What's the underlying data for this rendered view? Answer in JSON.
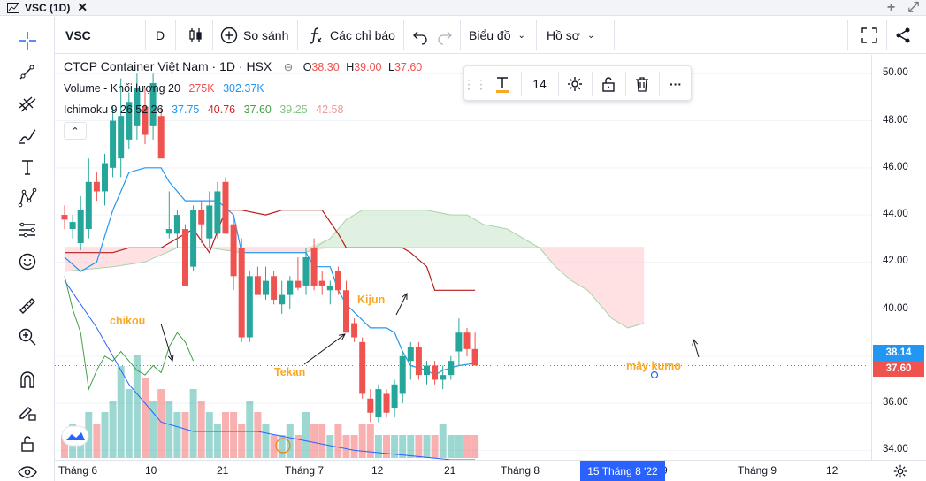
{
  "window": {
    "title": "VSC (1D)"
  },
  "toolbar": {
    "symbol": "VSC",
    "interval": "D",
    "compare_label": "So sánh",
    "indicators_label": "Các chỉ báo",
    "chart_label": "Biểu đồ",
    "profile_label": "Hồ sơ"
  },
  "legend": {
    "instrument": "CTCP Container Việt Nam · 1D · HSX",
    "ohlc": {
      "o_label": "O",
      "o_value": "38.30",
      "h_label": "H",
      "h_value": "39.00",
      "l_label": "L",
      "l_value": "37.60"
    },
    "volume": {
      "name": "Volume - Khối lượng 20",
      "value1": "275K",
      "value2": "302.37K"
    },
    "ichimoku": {
      "name": "Ichimoku 9 26 52 26",
      "v1": "37.75",
      "v2": "40.76",
      "v3": "37.60",
      "v4": "39.25",
      "v5": "42.58"
    }
  },
  "text_toolbar": {
    "font_size": "14"
  },
  "price_axis": {
    "labels": [
      "50.00",
      "48.00",
      "46.00",
      "44.00",
      "42.00",
      "40.00",
      "36.00",
      "34.00"
    ],
    "crosshair_tag": "38.14",
    "last_price_tag": "37.60"
  },
  "time_axis": {
    "labels": [
      "Tháng 6",
      "10",
      "21",
      "Tháng 7",
      "12",
      "21",
      "Tháng 8",
      "9",
      "Tháng 9",
      "12"
    ],
    "cursor_tag": "15 Tháng 8 '22"
  },
  "annotations": {
    "chikou": "chikou",
    "kijun": "Kijun",
    "tekan": "Tekan",
    "kumo": "mây kumo"
  },
  "colors": {
    "up": "#26a69a",
    "down": "#ef5350",
    "tenkan": "#2196f3",
    "kijun": "#b71c1c",
    "chikou": "#43a047",
    "kumo_green": "#c8e6c9",
    "kumo_red": "#ffcdd2",
    "annotation": "#f9a825",
    "accent": "#2962ff"
  },
  "chart_data": {
    "type": "candlestick",
    "ylim": [
      33.6,
      50.8
    ],
    "candles": [
      {
        "o": 44.0,
        "h": 44.4,
        "l": 43.4,
        "c": 43.8
      },
      {
        "o": 43.4,
        "h": 44.0,
        "l": 43.0,
        "c": 43.7
      },
      {
        "o": 42.8,
        "h": 44.8,
        "l": 42.5,
        "c": 44.2
      },
      {
        "o": 43.4,
        "h": 46.4,
        "l": 43.0,
        "c": 45.4
      },
      {
        "o": 45.4,
        "h": 45.8,
        "l": 44.6,
        "c": 45.0
      },
      {
        "o": 45.0,
        "h": 46.6,
        "l": 44.4,
        "c": 46.2
      },
      {
        "o": 46.0,
        "h": 48.6,
        "l": 45.6,
        "c": 48.0
      },
      {
        "o": 46.4,
        "h": 49.8,
        "l": 45.6,
        "c": 48.2
      },
      {
        "o": 47.2,
        "h": 49.2,
        "l": 46.8,
        "c": 48.8
      },
      {
        "o": 47.8,
        "h": 50.0,
        "l": 47.2,
        "c": 49.4
      },
      {
        "o": 48.6,
        "h": 49.4,
        "l": 47.0,
        "c": 47.4
      },
      {
        "o": 47.8,
        "h": 50.0,
        "l": 47.2,
        "c": 49.6
      },
      {
        "o": 48.2,
        "h": 48.6,
        "l": 46.4,
        "c": 46.4
      },
      {
        "o": 43.2,
        "h": 45.0,
        "l": 43.0,
        "c": 43.4
      },
      {
        "o": 43.2,
        "h": 44.2,
        "l": 42.6,
        "c": 44.0
      },
      {
        "o": 43.4,
        "h": 43.6,
        "l": 41.0,
        "c": 41.0
      },
      {
        "o": 41.8,
        "h": 44.4,
        "l": 41.6,
        "c": 44.2
      },
      {
        "o": 44.2,
        "h": 44.6,
        "l": 42.8,
        "c": 43.6
      },
      {
        "o": 43.0,
        "h": 45.0,
        "l": 42.6,
        "c": 44.4
      },
      {
        "o": 43.2,
        "h": 45.4,
        "l": 43.0,
        "c": 45.0
      },
      {
        "o": 45.4,
        "h": 45.6,
        "l": 43.2,
        "c": 43.2
      },
      {
        "o": 43.6,
        "h": 43.8,
        "l": 40.8,
        "c": 41.4
      },
      {
        "o": 42.6,
        "h": 43.0,
        "l": 38.6,
        "c": 38.8
      },
      {
        "o": 38.8,
        "h": 41.6,
        "l": 38.6,
        "c": 41.4
      },
      {
        "o": 41.4,
        "h": 41.8,
        "l": 40.6,
        "c": 40.6
      },
      {
        "o": 40.6,
        "h": 41.8,
        "l": 40.4,
        "c": 41.2
      },
      {
        "o": 41.4,
        "h": 41.6,
        "l": 40.2,
        "c": 40.4
      },
      {
        "o": 40.2,
        "h": 41.2,
        "l": 39.8,
        "c": 40.6
      },
      {
        "o": 40.6,
        "h": 41.4,
        "l": 40.0,
        "c": 41.2
      },
      {
        "o": 41.2,
        "h": 42.2,
        "l": 40.8,
        "c": 40.9
      },
      {
        "o": 41.0,
        "h": 42.6,
        "l": 40.6,
        "c": 42.2
      },
      {
        "o": 42.6,
        "h": 43.0,
        "l": 40.8,
        "c": 41.0
      },
      {
        "o": 41.2,
        "h": 41.6,
        "l": 40.6,
        "c": 41.0
      },
      {
        "o": 40.8,
        "h": 41.2,
        "l": 40.2,
        "c": 41.0
      },
      {
        "o": 41.6,
        "h": 41.8,
        "l": 40.6,
        "c": 40.8
      },
      {
        "o": 40.8,
        "h": 41.2,
        "l": 39.0,
        "c": 39.0
      },
      {
        "o": 39.4,
        "h": 39.6,
        "l": 38.6,
        "c": 38.8
      },
      {
        "o": 38.6,
        "h": 38.8,
        "l": 36.2,
        "c": 36.4
      },
      {
        "o": 36.2,
        "h": 36.6,
        "l": 35.2,
        "c": 35.6
      },
      {
        "o": 35.4,
        "h": 36.8,
        "l": 35.2,
        "c": 36.6
      },
      {
        "o": 36.4,
        "h": 36.6,
        "l": 35.4,
        "c": 35.6
      },
      {
        "o": 35.8,
        "h": 37.0,
        "l": 35.4,
        "c": 36.8
      },
      {
        "o": 36.4,
        "h": 38.2,
        "l": 36.0,
        "c": 38.0
      },
      {
        "o": 37.8,
        "h": 38.6,
        "l": 37.0,
        "c": 38.4
      },
      {
        "o": 38.4,
        "h": 38.6,
        "l": 37.0,
        "c": 37.2
      },
      {
        "o": 37.2,
        "h": 37.8,
        "l": 36.8,
        "c": 37.6
      },
      {
        "o": 37.6,
        "h": 37.8,
        "l": 36.8,
        "c": 37.0
      },
      {
        "o": 37.0,
        "h": 37.6,
        "l": 36.6,
        "c": 37.2
      },
      {
        "o": 37.2,
        "h": 38.0,
        "l": 37.0,
        "c": 37.8
      },
      {
        "o": 38.2,
        "h": 39.6,
        "l": 37.6,
        "c": 39.0
      },
      {
        "o": 39.0,
        "h": 39.2,
        "l": 38.0,
        "c": 38.3
      },
      {
        "o": 38.3,
        "h": 39.0,
        "l": 37.6,
        "c": 37.6
      }
    ],
    "volume_bars": [
      2,
      3,
      2,
      4,
      3,
      4,
      5,
      8,
      6,
      9,
      7,
      5,
      6,
      5,
      4,
      4,
      6,
      5,
      4,
      3,
      4,
      4,
      3,
      5,
      4,
      3,
      2,
      2,
      3,
      2,
      4,
      3,
      3,
      2,
      3,
      2,
      2,
      3,
      3,
      2,
      2,
      2,
      2,
      2,
      2,
      2,
      2,
      3,
      2,
      2,
      2,
      2
    ],
    "tenkan": [
      [
        0,
        42.2
      ],
      [
        2,
        41.6
      ],
      [
        4,
        42.0
      ],
      [
        6,
        44.2
      ],
      [
        8,
        45.8
      ],
      [
        10,
        46.0
      ],
      [
        12,
        46.0
      ],
      [
        13,
        45.4
      ],
      [
        15,
        44.6
      ],
      [
        17,
        44.6
      ],
      [
        19,
        44.6
      ],
      [
        21,
        44.0
      ],
      [
        22,
        42.4
      ],
      [
        23,
        42.4
      ],
      [
        27,
        42.4
      ],
      [
        30,
        42.4
      ],
      [
        31,
        41.8
      ],
      [
        33,
        41.8
      ],
      [
        34,
        40.8
      ],
      [
        35,
        40.2
      ],
      [
        38,
        39.2
      ],
      [
        40,
        39.2
      ],
      [
        41,
        39.0
      ],
      [
        42,
        38.2
      ],
      [
        43,
        37.6
      ],
      [
        45,
        37.4
      ],
      [
        46,
        37.2
      ],
      [
        47,
        37.4
      ],
      [
        49,
        37.6
      ],
      [
        51,
        37.7
      ]
    ],
    "kijun": [
      [
        0,
        42.4
      ],
      [
        6,
        42.4
      ],
      [
        8,
        42.6
      ],
      [
        10,
        42.6
      ],
      [
        12,
        42.6
      ],
      [
        14,
        43.0
      ],
      [
        16,
        43.4
      ],
      [
        18,
        42.4
      ],
      [
        20,
        44.2
      ],
      [
        22,
        44.2
      ],
      [
        25,
        44.0
      ],
      [
        27,
        44.2
      ],
      [
        32,
        44.2
      ],
      [
        34,
        43.2
      ],
      [
        35,
        42.6
      ],
      [
        36,
        42.6
      ],
      [
        42,
        42.6
      ],
      [
        43,
        42.4
      ],
      [
        45,
        41.8
      ],
      [
        46,
        40.8
      ],
      [
        48,
        40.8
      ],
      [
        51,
        40.8
      ]
    ],
    "chikou": [
      [
        0,
        41.4
      ],
      [
        1,
        40.0
      ],
      [
        2,
        39.0
      ],
      [
        3,
        36.6
      ],
      [
        4,
        37.4
      ],
      [
        5,
        38.0
      ],
      [
        6,
        37.8
      ],
      [
        7,
        38.2
      ],
      [
        8,
        37.8
      ],
      [
        9,
        37.4
      ],
      [
        10,
        37.2
      ],
      [
        11,
        37.6
      ],
      [
        12,
        37.3
      ],
      [
        13,
        38.4
      ],
      [
        14,
        39.0
      ],
      [
        15,
        38.6
      ],
      [
        16,
        37.8
      ]
    ],
    "senkou_a": [
      [
        0,
        41.6
      ],
      [
        6,
        41.8
      ],
      [
        10,
        42.0
      ],
      [
        14,
        42.6
      ],
      [
        18,
        42.6
      ],
      [
        22,
        42.4
      ],
      [
        26,
        42.4
      ],
      [
        30,
        42.4
      ],
      [
        33,
        43.0
      ],
      [
        35,
        43.8
      ],
      [
        37,
        44.2
      ],
      [
        41,
        44.2
      ],
      [
        45,
        44.2
      ],
      [
        48,
        44.0
      ],
      [
        50,
        44.0
      ],
      [
        51,
        43.8
      ],
      [
        52,
        43.6
      ],
      [
        55,
        43.4
      ],
      [
        57,
        43.0
      ],
      [
        59,
        42.6
      ],
      [
        61,
        41.8
      ],
      [
        63,
        41.2
      ],
      [
        65,
        40.8
      ],
      [
        66,
        40.4
      ],
      [
        68,
        39.6
      ],
      [
        70,
        39.2
      ],
      [
        72,
        39.4
      ]
    ],
    "senkou_b": [
      [
        0,
        42.6
      ],
      [
        10,
        42.6
      ],
      [
        20,
        42.6
      ],
      [
        30,
        42.6
      ],
      [
        40,
        42.6
      ],
      [
        50,
        42.6
      ],
      [
        60,
        42.6
      ],
      [
        72,
        42.6
      ]
    ],
    "last_price": 37.6
  }
}
